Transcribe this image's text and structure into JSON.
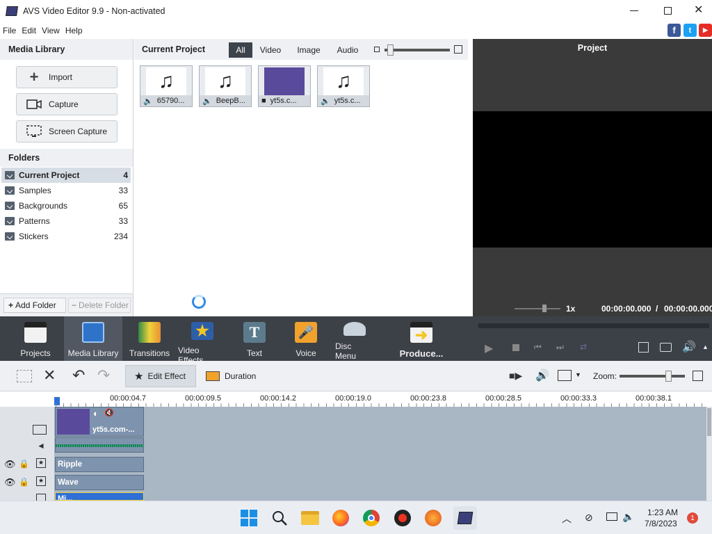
{
  "window": {
    "title": "AVS Video Editor 9.9 - Non-activated"
  },
  "menu": [
    "File",
    "Edit",
    "View",
    "Help"
  ],
  "media_library": {
    "header": "Media Library",
    "buttons": [
      "Import",
      "Capture",
      "Screen Capture"
    ],
    "folders_header": "Folders",
    "folders": [
      {
        "name": "Current Project",
        "count": "4"
      },
      {
        "name": "Samples",
        "count": "33"
      },
      {
        "name": "Backgrounds",
        "count": "65"
      },
      {
        "name": "Patterns",
        "count": "33"
      },
      {
        "name": "Stickers",
        "count": "234"
      }
    ],
    "add_folder": "Add Folder",
    "delete_folder": "Delete Folder"
  },
  "current_project": {
    "header": "Current Project",
    "filters": [
      "All",
      "Video",
      "Image",
      "Audio"
    ],
    "items": [
      {
        "label": "65790...",
        "kind": "audio"
      },
      {
        "label": "BeepB...",
        "kind": "audio"
      },
      {
        "label": "yt5s.c...",
        "kind": "video"
      },
      {
        "label": "yt5s.c...",
        "kind": "audio"
      }
    ]
  },
  "preview": {
    "header": "Project",
    "speed": "1x",
    "time_current": "00:00:00.000",
    "time_sep": "/",
    "time_total": "00:00:00.000"
  },
  "main_toolbar": [
    "Projects",
    "Media Library",
    "Transitions",
    "Video Effects",
    "Text",
    "Voice",
    "Disc Menu",
    "Produce..."
  ],
  "timeline_toolbar": {
    "edit_effect": "Edit Effect",
    "duration": "Duration",
    "zoom": "Zoom:"
  },
  "ruler": [
    "00:00:04.7",
    "00:00:09.5",
    "00:00:14.2",
    "00:00:19.0",
    "00:00:23.8",
    "00:00:28.5",
    "00:00:33.3",
    "00:00:38.1"
  ],
  "clips": {
    "video": "yt5s.com-...",
    "ripple": "Ripple",
    "wave": "Wave",
    "third": "Mi..."
  },
  "taskbar": {
    "time": "1:23 AM",
    "date": "7/8/2023",
    "badge": "1"
  },
  "colors": {
    "accent": "#2f6fd6",
    "dark_toolbar": "#3c4047",
    "preview_bg": "#000000",
    "clip_purple": "#5a4a9c"
  }
}
